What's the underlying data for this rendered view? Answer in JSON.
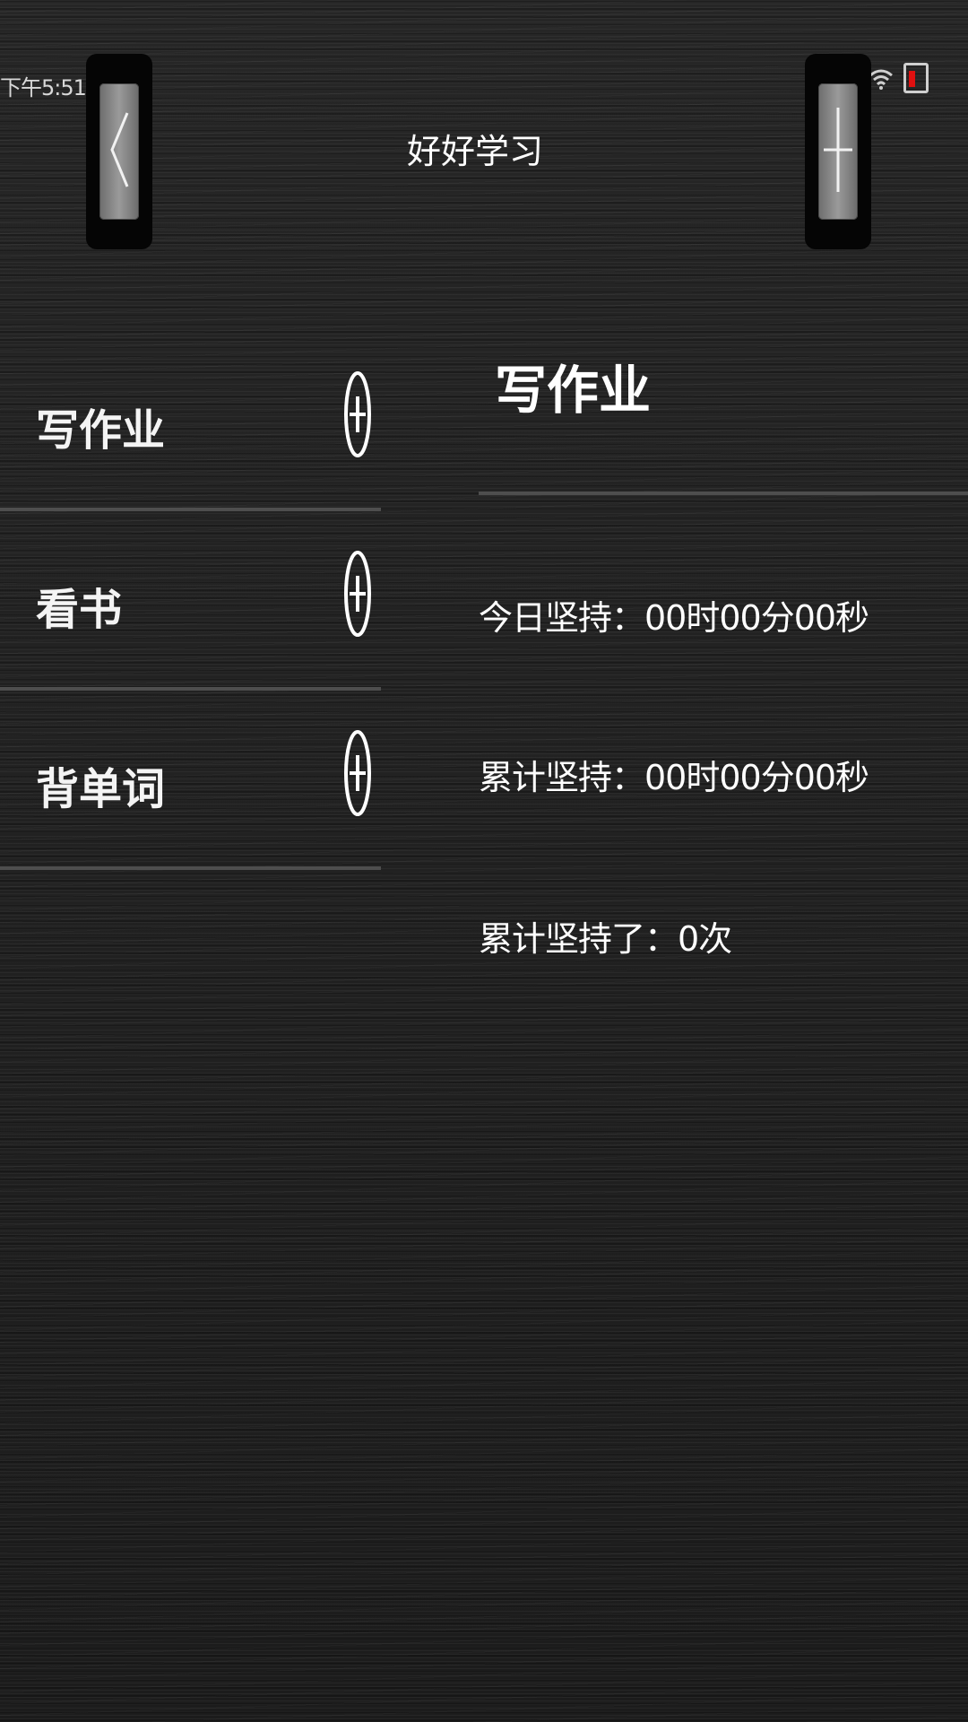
{
  "status_bar": {
    "time": "下午5:51",
    "icons": [
      "bluetooth-icon",
      "signal-icon",
      "wifi-icon",
      "battery-low-icon"
    ],
    "battery_color": "#e01010"
  },
  "header": {
    "title": "好好学习",
    "back_icon": "chevron-left-icon",
    "add_icon": "plus-icon"
  },
  "tasks": [
    {
      "label": "写作业",
      "icon": "plus-circle-icon"
    },
    {
      "label": "看书",
      "icon": "plus-circle-icon"
    },
    {
      "label": "背单词",
      "icon": "plus-circle-icon"
    }
  ],
  "detail": {
    "title": "写作业",
    "today": "今日坚持：00时00分00秒",
    "total": "累计坚持：00时00分00秒",
    "count": "累计坚持了：0次"
  }
}
